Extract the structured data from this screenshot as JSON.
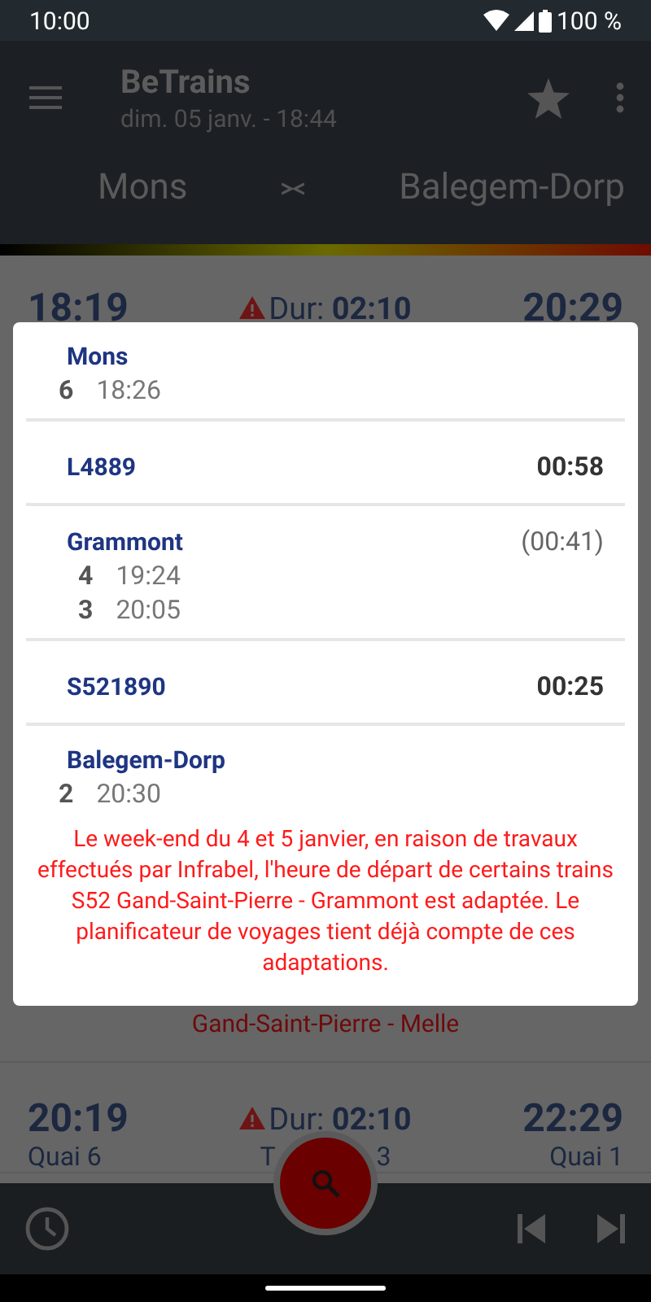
{
  "status_bar": {
    "time": "10:00",
    "battery": "100 %"
  },
  "app_bar": {
    "title": "BeTrains",
    "subtitle": "dim. 05 janv. - 18:44",
    "from": "Mons",
    "to": "Balegem-Dorp"
  },
  "results": [
    {
      "departure": "18:19",
      "warning": true,
      "duration": "Dur: **02:10**",
      "arrival": "20:29",
      "alert": "Gand-Saint-Pierre - Melle"
    },
    {
      "departure": "20:19",
      "warning": true,
      "duration": "Dur: **02:10**",
      "arrival": "22:29",
      "departure_platform": "Quai 6",
      "trains_parts": [
        "T",
        "3"
      ],
      "arrival_platform": "Quai 1"
    }
  ],
  "dialog": {
    "sections": [
      {
        "kind": "stop",
        "name": "Mons",
        "stops": [
          {
            "platform": "6",
            "time": "18:26"
          }
        ]
      },
      {
        "kind": "train",
        "name": "L4889",
        "duration": "00:58"
      },
      {
        "kind": "stop",
        "name": "Grammont",
        "duration": "(00:41)",
        "stops": [
          {
            "platform": "4",
            "time": "19:24"
          },
          {
            "platform": "3",
            "time": "20:05"
          }
        ]
      },
      {
        "kind": "train",
        "name": "S521890",
        "duration": "00:25"
      },
      {
        "kind": "stop",
        "name": "Balegem-Dorp",
        "stops": [
          {
            "platform": "2",
            "time": "20:30"
          }
        ]
      }
    ],
    "message": "Le week-end du 4 et 5 janvier, en raison de travaux effectués par Infrabel, l'heure de départ de certains trains S52 Gand-Saint-Pierre - Grammont est adaptée. Le planificateur de voyages tient déjà compte de ces adaptations."
  }
}
